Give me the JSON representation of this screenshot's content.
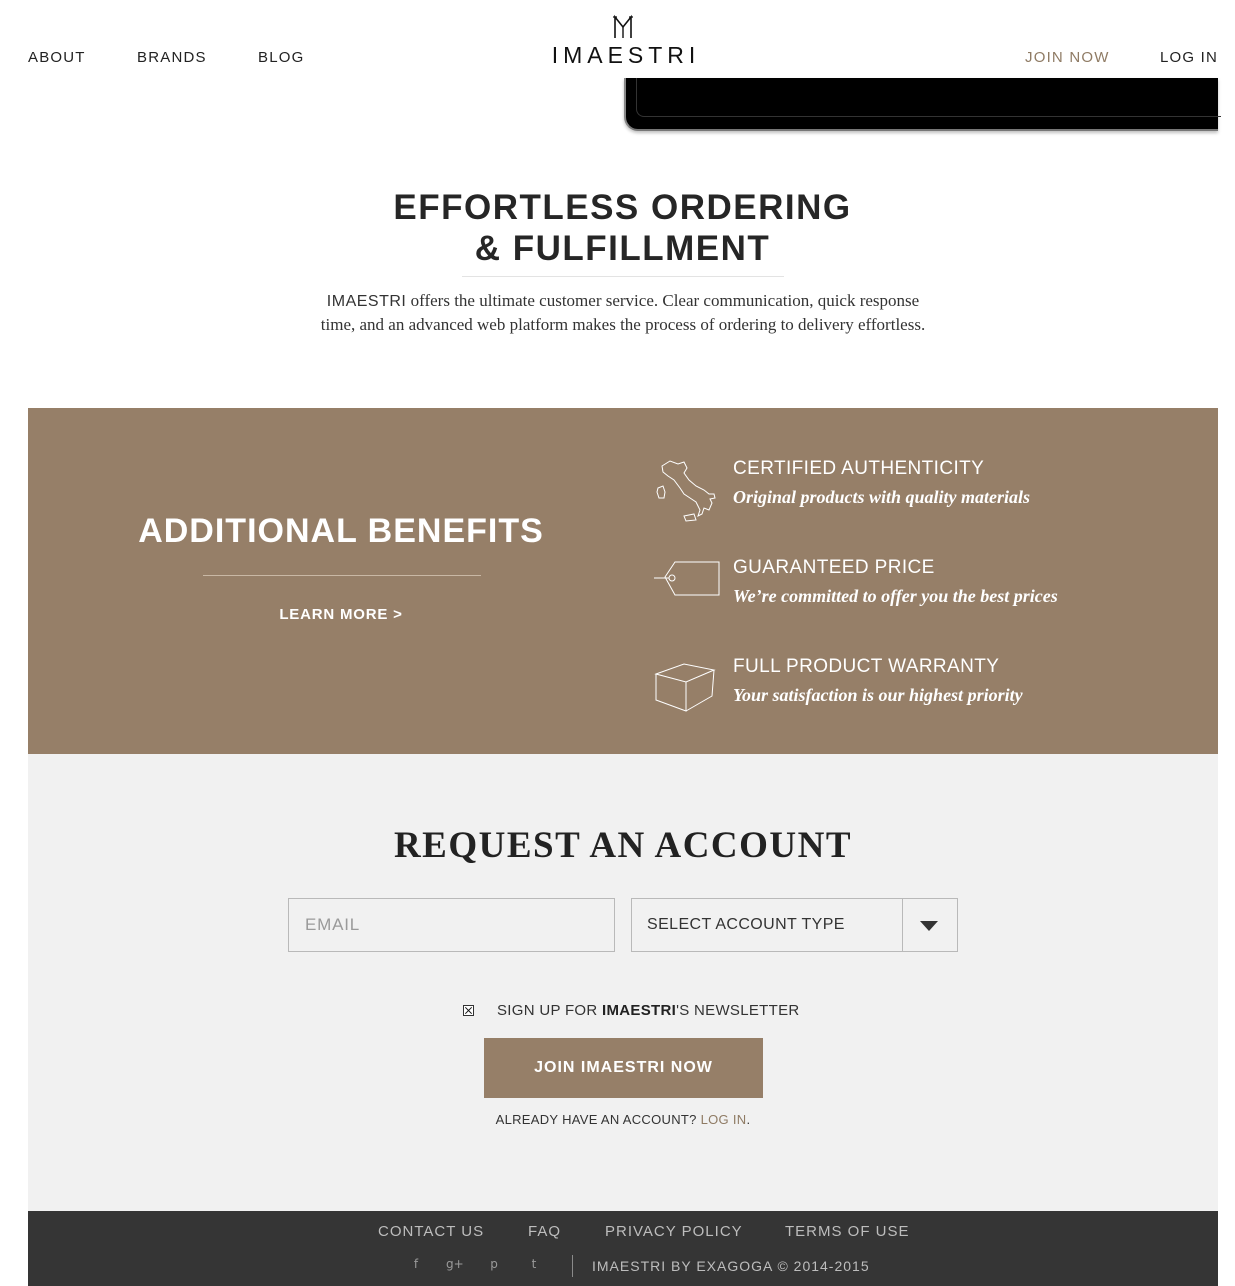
{
  "header": {
    "nav_left": [
      "ABOUT",
      "BRANDS",
      "BLOG"
    ],
    "logo_text": "IMAESTRI",
    "join_label": "JOIN NOW",
    "login_label": "LOG IN",
    "accent_color": "#8f7b64"
  },
  "hero": {
    "title_line1": "EFFORTLESS ORDERING",
    "title_line2": "& FULFILLMENT",
    "desc_brand": "IMAESTRI",
    "desc_text": " offers the ultimate customer service. Clear communication, quick response time, and an advanced web platform makes the process of ordering to delivery effortless."
  },
  "benefits": {
    "background": "#967f68",
    "title": "ADDITIONAL BENEFITS",
    "learn_more": "LEARN MORE >",
    "items": [
      {
        "icon": "italy-map-icon",
        "heading": "CERTIFIED AUTHENTICITY",
        "sub": "Original products with quality materials"
      },
      {
        "icon": "price-tag-icon",
        "heading": "GUARANTEED PRICE",
        "sub": "We’re committed to offer you the best prices"
      },
      {
        "icon": "box-icon",
        "heading": "FULL PRODUCT WARRANTY",
        "sub": "Your satisfaction is our highest priority"
      }
    ]
  },
  "request": {
    "title": "REQUEST AN ACCOUNT",
    "email_placeholder": "EMAIL",
    "select_label": "SELECT ACCOUNT TYPE",
    "newsletter_prefix": "SIGN UP FOR ",
    "newsletter_brand": "IMAESTRI",
    "newsletter_suffix": "'S NEWSLETTER",
    "newsletter_checked": true,
    "join_button": "JOIN IMAESTRI NOW",
    "already_text": "ALREADY HAVE AN ACCOUNT? ",
    "already_link": "LOG IN",
    "already_end": "."
  },
  "footer": {
    "links": [
      "CONTACT US",
      "FAQ",
      "PRIVACY POLICY",
      "TERMS OF USE"
    ],
    "social_icons": [
      "facebook-icon",
      "google-plus-icon",
      "pinterest-icon",
      "twitter-icon"
    ],
    "social_glyphs": [
      "f",
      "g+",
      "p",
      "t"
    ],
    "copyright": "IMAESTRI BY EXAGOGA © 2014-2015"
  }
}
